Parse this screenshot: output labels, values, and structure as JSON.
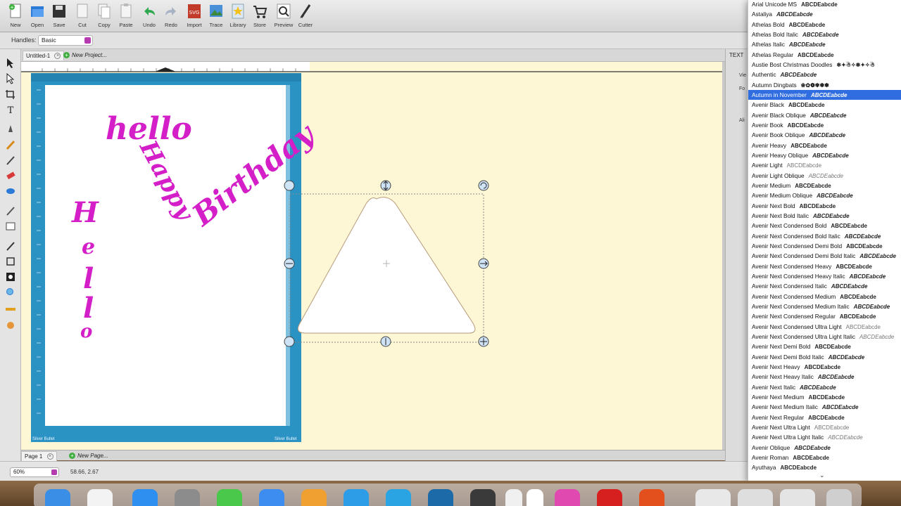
{
  "toolbar": {
    "buttons": [
      {
        "label": "New",
        "icon": "new-document-icon"
      },
      {
        "label": "Open",
        "icon": "open-folder-icon"
      },
      {
        "label": "Save",
        "icon": "save-disk-icon"
      },
      {
        "label": "Cut",
        "icon": "cut-icon"
      },
      {
        "label": "Copy",
        "icon": "copy-icon"
      },
      {
        "label": "Paste",
        "icon": "paste-icon"
      },
      {
        "label": "Undo",
        "icon": "undo-arrow-icon"
      },
      {
        "label": "Redo",
        "icon": "redo-arrow-icon"
      },
      {
        "label": "Import",
        "icon": "import-svg-icon"
      },
      {
        "label": "Trace",
        "icon": "trace-image-icon"
      },
      {
        "label": "Library",
        "icon": "library-star-icon"
      },
      {
        "label": "Store",
        "icon": "store-cart-icon"
      },
      {
        "label": "Preview",
        "icon": "preview-magnifier-icon"
      },
      {
        "label": "Cutter",
        "icon": "cutter-blade-icon"
      }
    ]
  },
  "handles": {
    "label": "Handles:",
    "value": "Basic"
  },
  "doc_tabs": {
    "active": "Untitled-1",
    "new": "New Project..."
  },
  "page_tabs": {
    "page": "Page 1",
    "new": "New Page..."
  },
  "mat": {
    "brand_left": "Silver Bullet",
    "brand_right": "Silver Bullet"
  },
  "canvas_text": {
    "hello": "hello",
    "happy": "Happy",
    "birthday": "Birthday",
    "vertical": [
      "H",
      "e",
      "l",
      "l",
      "o"
    ]
  },
  "status": {
    "zoom": "60%",
    "coords": "58.66, 2.67"
  },
  "right_panel": {
    "tab": "TEXT",
    "frag1": "Vie",
    "frag2": "Fo",
    "frag3": "Ali"
  },
  "font_menu": {
    "selected": "Autumn in November",
    "items": [
      {
        "name": "Arial Unicode MS",
        "sample": "ABCDEabcde"
      },
      {
        "name": "Astaliya",
        "sample": "ABCDEabcde"
      },
      {
        "name": "Athelas Bold",
        "sample": "ABCDEabcde"
      },
      {
        "name": "Athelas Bold Italic",
        "sample": "ABCDEabcde"
      },
      {
        "name": "Athelas Italic",
        "sample": "ABCDEabcde"
      },
      {
        "name": "Athelas Regular",
        "sample": "ABCDEabcde"
      },
      {
        "name": "Austie Bost Christmas Doodles",
        "sample": "❄✦☃✧❅✦✧☃"
      },
      {
        "name": "Authentic",
        "sample": "ABCDEabcde"
      },
      {
        "name": "Autumn Dingbats",
        "sample": "❀✿❁✾❃✽"
      },
      {
        "name": "Autumn in November",
        "sample": "ABCDEabcde"
      },
      {
        "name": "Avenir Black",
        "sample": "ABCDEabcde"
      },
      {
        "name": "Avenir Black Oblique",
        "sample": "ABCDEabcde"
      },
      {
        "name": "Avenir Book",
        "sample": "ABCDEabcde"
      },
      {
        "name": "Avenir Book Oblique",
        "sample": "ABCDEabcde"
      },
      {
        "name": "Avenir Heavy",
        "sample": "ABCDEabcde"
      },
      {
        "name": "Avenir Heavy Oblique",
        "sample": "ABCDEabcde"
      },
      {
        "name": "Avenir Light",
        "sample": "ABCDEabcde"
      },
      {
        "name": "Avenir Light Oblique",
        "sample": "ABCDEabcde"
      },
      {
        "name": "Avenir Medium",
        "sample": "ABCDEabcde"
      },
      {
        "name": "Avenir Medium Oblique",
        "sample": "ABCDEabcde"
      },
      {
        "name": "Avenir Next Bold",
        "sample": "ABCDEabcde"
      },
      {
        "name": "Avenir Next Bold Italic",
        "sample": "ABCDEabcde"
      },
      {
        "name": "Avenir Next Condensed Bold",
        "sample": "ABCDEabcde"
      },
      {
        "name": "Avenir Next Condensed Bold Italic",
        "sample": "ABCDEabcde"
      },
      {
        "name": "Avenir Next Condensed Demi Bold",
        "sample": "ABCDEabcde"
      },
      {
        "name": "Avenir Next Condensed Demi Bold Italic",
        "sample": "ABCDEabcde"
      },
      {
        "name": "Avenir Next Condensed Heavy",
        "sample": "ABCDEabcde"
      },
      {
        "name": "Avenir Next Condensed Heavy Italic",
        "sample": "ABCDEabcde"
      },
      {
        "name": "Avenir Next Condensed Italic",
        "sample": "ABCDEabcde"
      },
      {
        "name": "Avenir Next Condensed Medium",
        "sample": "ABCDEabcde"
      },
      {
        "name": "Avenir Next Condensed Medium Italic",
        "sample": "ABCDEabcde"
      },
      {
        "name": "Avenir Next Condensed Regular",
        "sample": "ABCDEabcde"
      },
      {
        "name": "Avenir Next Condensed Ultra Light",
        "sample": "ABCDEabcde"
      },
      {
        "name": "Avenir Next Condensed Ultra Light Italic",
        "sample": "ABCDEabcde"
      },
      {
        "name": "Avenir Next Demi Bold",
        "sample": "ABCDEabcde"
      },
      {
        "name": "Avenir Next Demi Bold Italic",
        "sample": "ABCDEabcde"
      },
      {
        "name": "Avenir Next Heavy",
        "sample": "ABCDEabcde"
      },
      {
        "name": "Avenir Next Heavy Italic",
        "sample": "ABCDEabcde"
      },
      {
        "name": "Avenir Next Italic",
        "sample": "ABCDEabcde"
      },
      {
        "name": "Avenir Next Medium",
        "sample": "ABCDEabcde"
      },
      {
        "name": "Avenir Next Medium Italic",
        "sample": "ABCDEabcde"
      },
      {
        "name": "Avenir Next Regular",
        "sample": "ABCDEabcde"
      },
      {
        "name": "Avenir Next Ultra Light",
        "sample": "ABCDEabcde"
      },
      {
        "name": "Avenir Next Ultra Light Italic",
        "sample": "ABCDEabcde"
      },
      {
        "name": "Avenir Oblique",
        "sample": "ABCDEabcde"
      },
      {
        "name": "Avenir Roman",
        "sample": "ABCDEabcde"
      },
      {
        "name": "Ayuthaya",
        "sample": "ABCDEabcde"
      }
    ]
  },
  "colors": {
    "accent_magenta": "#d41fc9",
    "mat_blue": "#2a93c4",
    "selection_blue": "#2f6de0",
    "workspace": "#fdf7d6"
  }
}
